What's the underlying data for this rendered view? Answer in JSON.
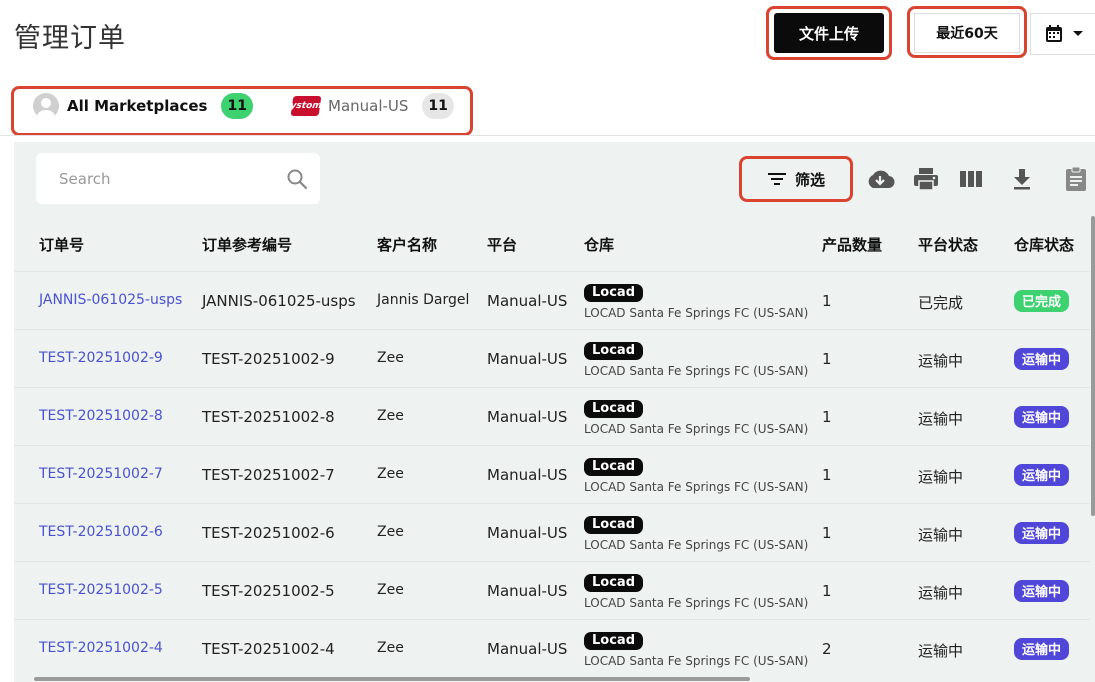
{
  "header": {
    "title": "管理订单",
    "upload_label": "文件上传",
    "range_label": "最近60天"
  },
  "marketplaces": [
    {
      "label": "All Marketplaces",
      "count": "11",
      "active": true
    },
    {
      "label": "Manual-US",
      "count": "11",
      "active": false,
      "logo_text": "ystom"
    }
  ],
  "toolbar": {
    "search_placeholder": "Search",
    "filter_label": "筛选",
    "icons": [
      "cloud-download-icon",
      "print-icon",
      "columns-icon",
      "download-icon",
      "clipboard-icon"
    ]
  },
  "table": {
    "columns": [
      "订单号",
      "订单参考编号",
      "客户名称",
      "平台",
      "仓库",
      "产品数量",
      "平台状态",
      "仓库状态"
    ],
    "rows": [
      {
        "order": "JANNIS-061025-usps",
        "ref": "JANNIS-061025-usps",
        "customer": "Jannis Dargel",
        "platform": "Manual-US",
        "wh_tag": "Locad",
        "wh_name": "LOCAD Santa Fe Springs FC (US-SAN)",
        "qty": "1",
        "platform_status": "已完成",
        "wh_status": "已完成",
        "wh_status_type": "done"
      },
      {
        "order": "TEST-20251002-9",
        "ref": "TEST-20251002-9",
        "customer": "Zee",
        "platform": "Manual-US",
        "wh_tag": "Locad",
        "wh_name": "LOCAD Santa Fe Springs FC (US-SAN)",
        "qty": "1",
        "platform_status": "运输中",
        "wh_status": "运输中",
        "wh_status_type": "transit"
      },
      {
        "order": "TEST-20251002-8",
        "ref": "TEST-20251002-8",
        "customer": "Zee",
        "platform": "Manual-US",
        "wh_tag": "Locad",
        "wh_name": "LOCAD Santa Fe Springs FC (US-SAN)",
        "qty": "1",
        "platform_status": "运输中",
        "wh_status": "运输中",
        "wh_status_type": "transit"
      },
      {
        "order": "TEST-20251002-7",
        "ref": "TEST-20251002-7",
        "customer": "Zee",
        "platform": "Manual-US",
        "wh_tag": "Locad",
        "wh_name": "LOCAD Santa Fe Springs FC (US-SAN)",
        "qty": "1",
        "platform_status": "运输中",
        "wh_status": "运输中",
        "wh_status_type": "transit"
      },
      {
        "order": "TEST-20251002-6",
        "ref": "TEST-20251002-6",
        "customer": "Zee",
        "platform": "Manual-US",
        "wh_tag": "Locad",
        "wh_name": "LOCAD Santa Fe Springs FC (US-SAN)",
        "qty": "1",
        "platform_status": "运输中",
        "wh_status": "运输中",
        "wh_status_type": "transit"
      },
      {
        "order": "TEST-20251002-5",
        "ref": "TEST-20251002-5",
        "customer": "Zee",
        "platform": "Manual-US",
        "wh_tag": "Locad",
        "wh_name": "LOCAD Santa Fe Springs FC (US-SAN)",
        "qty": "1",
        "platform_status": "运输中",
        "wh_status": "运输中",
        "wh_status_type": "transit"
      },
      {
        "order": "TEST-20251002-4",
        "ref": "TEST-20251002-4",
        "customer": "Zee",
        "platform": "Manual-US",
        "wh_tag": "Locad",
        "wh_name": "LOCAD Santa Fe Springs FC (US-SAN)",
        "qty": "2",
        "platform_status": "运输中",
        "wh_status": "运输中",
        "wh_status_type": "transit"
      }
    ]
  },
  "colors": {
    "highlight": "#d9432f",
    "link": "#4a52d0",
    "status_done": "#3dd16f",
    "status_transit": "#5046d8",
    "panel_bg": "#eef3f1"
  }
}
